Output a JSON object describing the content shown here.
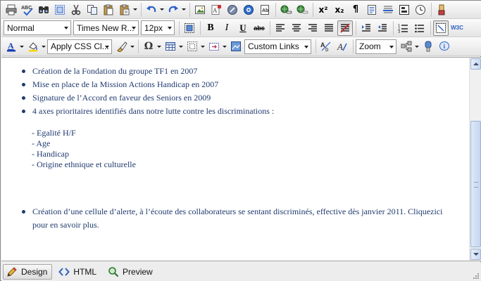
{
  "toolbar_row1": {
    "icons": [
      "print-icon",
      "spellcheck-icon",
      "find-icon",
      "select-all-icon",
      "cut-icon",
      "copy-icon",
      "paste-icon",
      "paste-special-icon",
      "undo-icon",
      "redo-icon",
      "image-icon",
      "flash-icon",
      "media-icon",
      "video-icon",
      "template-icon",
      "insert-link-icon",
      "remove-link-icon",
      "superscript-icon",
      "subscript-icon",
      "paragraph-icon",
      "document-icon",
      "hr-icon",
      "form-icon",
      "datetime-icon",
      "format-painter-icon"
    ],
    "spellcheck_label": "ABC",
    "superscript_label": "x²",
    "subscript_label": "x₂"
  },
  "toolbar_row2": {
    "paragraph_style": "Normal",
    "font_name": "Times New R...",
    "font_size": "12px",
    "bold_label": "B",
    "italic_label": "I",
    "underline_label": "U",
    "strike_label": "abc",
    "w3c_label": "W3C"
  },
  "toolbar_row3": {
    "css_class": "Apply CSS Cl...",
    "symbol_label": "Ω",
    "custom_links": "Custom Links",
    "zoom": "Zoom",
    "colors": {
      "font": "#1a3fb5",
      "highlight": "#ffd400"
    }
  },
  "content": {
    "items": [
      "Création de la Fondation du groupe TF1 en 2007",
      "Mise en place de la Mission Actions Handicap en 2007",
      "Signature de l’Accord en faveur des Seniors en 2009",
      "4 axes prioritaires identifiés dans notre lutte contre les discriminations :"
    ],
    "sub_items": [
      "- Egalité H/F",
      "- Age",
      "- Handicap",
      "- Origine ethnique et culturelle"
    ],
    "last_item": "Création d’une cellule d’alerte, à l’écoute des collaborateurs se sentant discriminés, effective dès janvier 2011. Cliquezici pour en savoir plus.",
    "text_color": "#1f3a6e"
  },
  "tabs": [
    {
      "label": "Design"
    },
    {
      "label": "HTML"
    },
    {
      "label": "Preview"
    }
  ]
}
